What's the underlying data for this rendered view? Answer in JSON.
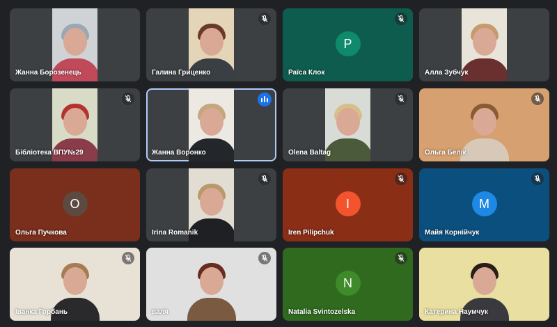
{
  "colors": {
    "page_bg": "#202124",
    "tile_bg": "#3c4043",
    "active_border": "#aecbfa",
    "speaking": "#1a73e8"
  },
  "participants": [
    {
      "name": "Жанна Борозенець",
      "video": true,
      "muted": false,
      "tile_bg": "#3c4043",
      "cam_bg": "#cfd3d6",
      "hair": "#9aa7b4",
      "cloth": "#c04a5a"
    },
    {
      "name": "Галина Гриценко",
      "video": true,
      "muted": true,
      "tile_bg": "#3c4043",
      "cam_bg": "#e4d4b8",
      "hair": "#6b3a26",
      "cloth": "#3a3f44"
    },
    {
      "name": "Раїса Клок",
      "video": false,
      "muted": true,
      "initial": "Р",
      "tile_bg": "#0d5c4d",
      "avatar_bg": "#0f8a6c"
    },
    {
      "name": "Алла Зубчук",
      "video": true,
      "muted": false,
      "tile_bg": "#3c4043",
      "cam_bg": "#e8e4da",
      "hair": "#c79a6b",
      "cloth": "#6a3030"
    },
    {
      "name": "Бібліотека ВПУ№29",
      "video": true,
      "muted": true,
      "tile_bg": "#3c4043",
      "cam_bg": "#d8dcc6",
      "hair": "#b5322f",
      "cloth": "#8a3c4a"
    },
    {
      "name": "Жанна Воронко",
      "video": true,
      "muted": false,
      "speaking": true,
      "active": true,
      "tile_bg": "#3c4043",
      "cam_bg": "#ece8e2",
      "hair": "#c4a77c",
      "cloth": "#23262a"
    },
    {
      "name": "Olena Baltag",
      "video": true,
      "muted": true,
      "tile_bg": "#3c4043",
      "cam_bg": "#d9dcd6",
      "hair": "#d6c08a",
      "cloth": "#4a5a3a"
    },
    {
      "name": "Ольга Белік",
      "video": true,
      "muted": true,
      "tile_bg": "#3c4043",
      "cam_bg": "#d6a070",
      "hair": "#8a5a32",
      "cloth": "#d8c8b8",
      "wide": true
    },
    {
      "name": "Ольга Пучкова",
      "video": false,
      "muted": false,
      "initial": "О",
      "tile_bg": "#7a2e1c",
      "avatar_bg": "#5c4a40"
    },
    {
      "name": "Irina Romanik",
      "video": true,
      "muted": true,
      "tile_bg": "#3c4043",
      "cam_bg": "#e2ddd2",
      "hair": "#b89a6a",
      "cloth": "#1e2024"
    },
    {
      "name": "Iren Pilipchuk",
      "video": false,
      "muted": true,
      "initial": "I",
      "tile_bg": "#8a2e16",
      "avatar_bg": "#f2542d"
    },
    {
      "name": "Майя Корнійчук",
      "video": false,
      "muted": true,
      "initial": "М",
      "tile_bg": "#0b4f7e",
      "avatar_bg": "#1e88e5"
    },
    {
      "name": "Іванка Горбань",
      "video": true,
      "muted": true,
      "tile_bg": "#3c4043",
      "cam_bg": "#e8e2d6",
      "hair": "#a67c52",
      "cloth": "#2a2a2c",
      "wide": true
    },
    {
      "name": "валя",
      "video": true,
      "muted": true,
      "tile_bg": "#3c4043",
      "cam_bg": "#e0e0e0",
      "hair": "#6a2a22",
      "cloth": "#7a5a40",
      "wide": true
    },
    {
      "name": "Natalia Svintozelska",
      "video": false,
      "muted": true,
      "initial": "N",
      "tile_bg": "#2f6a1e",
      "avatar_bg": "#3f8a2a"
    },
    {
      "name": "Катерина Наумчук",
      "video": true,
      "muted": false,
      "tile_bg": "#3c4043",
      "cam_bg": "#e8dfa0",
      "hair": "#2a1e18",
      "cloth": "#3a3a3e",
      "wide": true
    }
  ]
}
